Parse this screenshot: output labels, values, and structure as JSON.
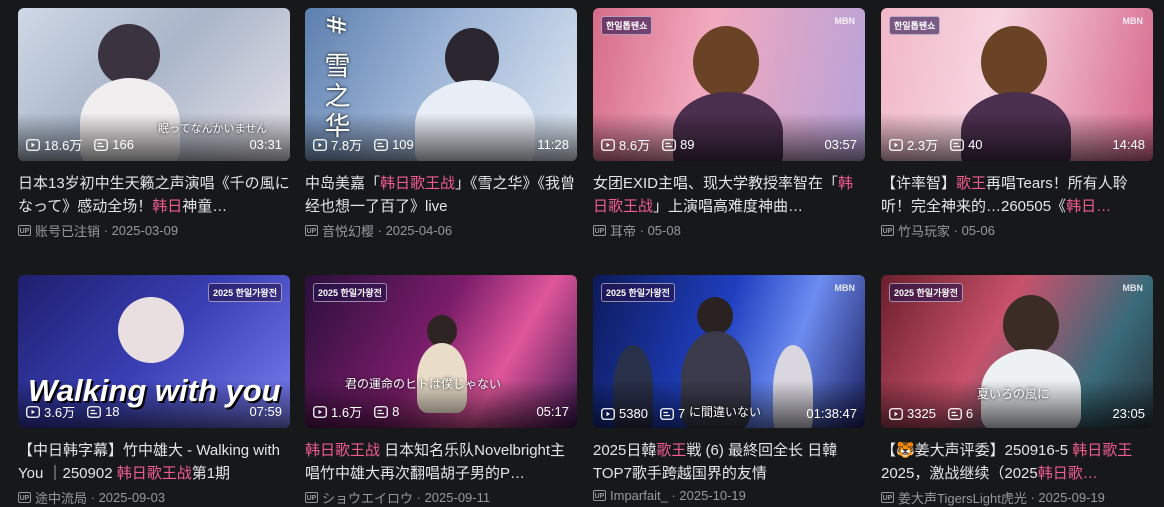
{
  "videos": [
    {
      "views": "18.6万",
      "danmaku": "166",
      "duration": "03:31",
      "title_parts": [
        {
          "text": "日本13岁初中生天籁之声演唱《千の風になって》感动全场！",
          "hl": false
        },
        {
          "text": "韩日",
          "hl": true
        },
        {
          "text": "神童…",
          "hl": false
        }
      ],
      "author": "账号已注销",
      "date": "2025-03-09",
      "logo": "",
      "subtitle": "眠ってなんかいません"
    },
    {
      "views": "7.8万",
      "danmaku": "109",
      "duration": "11:28",
      "title_parts": [
        {
          "text": "中岛美嘉「",
          "hl": false
        },
        {
          "text": "韩日歌王战",
          "hl": true
        },
        {
          "text": "」《雪之华》《我曾经也想一了百了》live",
          "hl": false
        }
      ],
      "author": "音悦幻樱",
      "date": "2025-04-06",
      "logo": "",
      "subtitle": "# 雪之华"
    },
    {
      "views": "8.6万",
      "danmaku": "89",
      "duration": "03:57",
      "title_parts": [
        {
          "text": "女团EXID主唱、现大学教授率智在「",
          "hl": false
        },
        {
          "text": "韩日歌王战",
          "hl": true
        },
        {
          "text": "」上演唱高难度神曲…",
          "hl": false
        }
      ],
      "author": "耳帝",
      "date": "05-08",
      "logo": "한일톱텐쇼",
      "subtitle": ""
    },
    {
      "views": "2.3万",
      "danmaku": "40",
      "duration": "14:48",
      "title_parts": [
        {
          "text": "【许率智】",
          "hl": false
        },
        {
          "text": "歌王",
          "hl": true
        },
        {
          "text": "再唱Tears！所有人聆听！完全神来的…260505《",
          "hl": false
        },
        {
          "text": "韩日…",
          "hl": true
        }
      ],
      "author": "竹马玩家",
      "date": "05-06",
      "logo": "한일톱텐쇼",
      "subtitle": ""
    },
    {
      "views": "3.6万",
      "danmaku": "18",
      "duration": "07:59",
      "title_parts": [
        {
          "text": "【中日韩字幕】竹中雄大 - Walking with You ｜250902 ",
          "hl": false
        },
        {
          "text": "韩日歌王战",
          "hl": true
        },
        {
          "text": "第1期",
          "hl": false
        }
      ],
      "author": "途中流局",
      "date": "2025-09-03",
      "logo": "2025 한일가왕전",
      "subtitle": "Walking with you"
    },
    {
      "views": "1.6万",
      "danmaku": "8",
      "duration": "05:17",
      "title_parts": [
        {
          "text": "韩日歌王战",
          "hl": true
        },
        {
          "text": " 日本知名乐队Novelbright主唱竹中雄大再次翻唱胡子男的P…",
          "hl": false
        }
      ],
      "author": "ショウエイロウ",
      "date": "2025-09-11",
      "logo": "2025 한일가왕전",
      "subtitle": "君の運命のヒトは僕じゃない"
    },
    {
      "views": "5380",
      "danmaku": "7",
      "duration": "01:38:47",
      "title_parts": [
        {
          "text": "2025日韓",
          "hl": false
        },
        {
          "text": "歌王",
          "hl": true
        },
        {
          "text": "戦 (6) 最終回全长 日韓TOP7歌手跨越国界的友情",
          "hl": false
        }
      ],
      "author": "Imparfait_",
      "date": "2025-10-19",
      "logo": "2025 한일가왕전",
      "subtitle": "に間違いない"
    },
    {
      "views": "3325",
      "danmaku": "6",
      "duration": "23:05",
      "title_parts": [
        {
          "text": "【🐯姜大声评委】250916-5 ",
          "hl": false
        },
        {
          "text": "韩日歌王",
          "hl": true
        },
        {
          "text": "2025，激战继续（2025",
          "hl": false
        },
        {
          "text": "韩日歌…",
          "hl": true
        }
      ],
      "author": "姜大声TigersLight虎光",
      "date": "2025-09-19",
      "logo": "2025 한일가왕전",
      "subtitle": "夏いろの風に"
    }
  ],
  "channel_mark": "MBN",
  "colors": {
    "background": "#17181a",
    "highlight": "#f25d8e",
    "meta": "#9499a0"
  }
}
